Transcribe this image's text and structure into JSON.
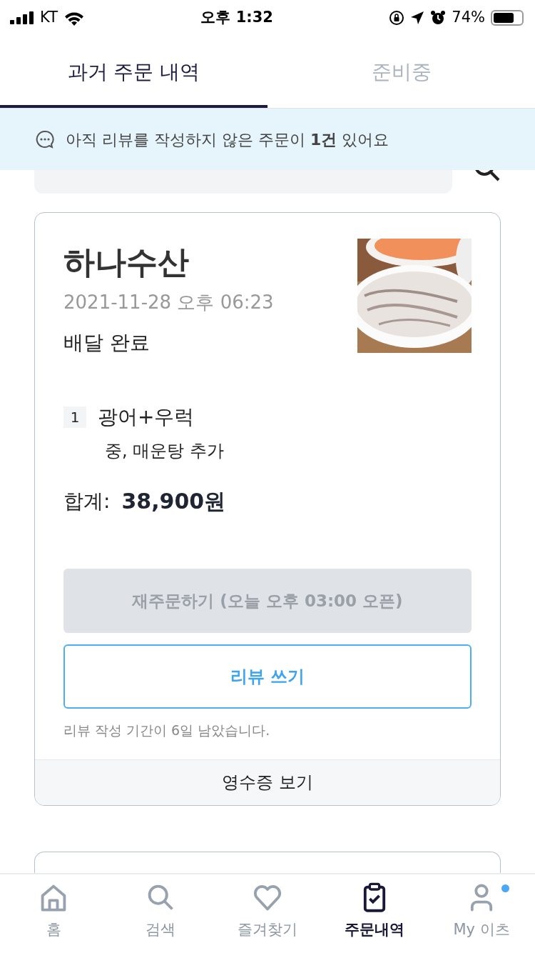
{
  "status_bar": {
    "carrier": "KT",
    "time": "오후 1:32",
    "battery": "74%"
  },
  "tabs": [
    {
      "label": "과거 주문 내역",
      "selected": true
    },
    {
      "label": "준비중",
      "selected": false
    }
  ],
  "banner": {
    "text": "아직 리뷰를 작성하지 않은 주문이 **1건** 있어요"
  },
  "orders": [
    {
      "store": "하나수산",
      "datetime": "2021-11-28 오후 06:23",
      "status": "배달 완료",
      "image": {
        "kind": "picture"
      },
      "items": [
        {
          "quantity": "1",
          "name": "광어+우럭",
          "options": "중, 매운탕 추가"
        }
      ],
      "total_label": "합계:",
      "total": "38,900원",
      "reorder_button": {
        "label": "재주문하기 (오늘 오후 03:00 오픈)",
        "disabled": true
      },
      "review_button": {
        "label": "리뷰 쓰기",
        "disabled": false
      },
      "review_note": "리뷰 작성 기간이 6일 남았습니다.",
      "receipt_button": "영수증 보기"
    }
  ],
  "bottom_nav": [
    {
      "label": "홈",
      "kind": "home",
      "selected": false,
      "notification": false
    },
    {
      "label": "검색",
      "kind": "search",
      "selected": false,
      "notification": false
    },
    {
      "label": "즐겨찾기",
      "kind": "heart",
      "selected": false,
      "notification": false
    },
    {
      "label": "주문내역",
      "kind": "clipboard",
      "selected": true,
      "notification": false
    },
    {
      "label": "My 이츠",
      "kind": "person",
      "selected": false,
      "notification": true
    }
  ]
}
